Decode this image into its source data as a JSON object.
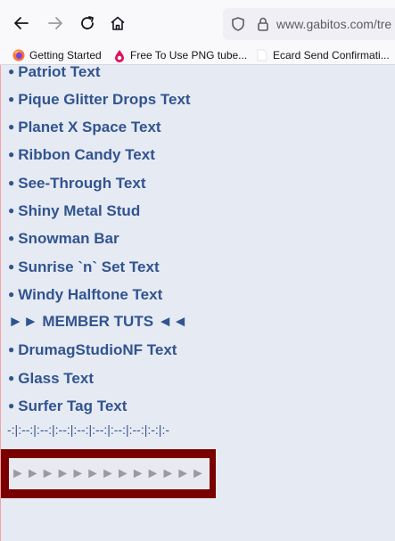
{
  "browser": {
    "url": "www.gabitos.com/tre",
    "bookmarks": [
      {
        "label": "Getting Started",
        "icon": "firefox-icon"
      },
      {
        "label": "Free To Use PNG tube...",
        "icon": "pink-drop-icon"
      },
      {
        "label": "Ecard Send Confirmati...",
        "icon": "blank-page-icon"
      }
    ]
  },
  "content": {
    "items": [
      "Patriot Text",
      "Pique Glitter Drops Text",
      "Planet X Space Text",
      "Ribbon Candy Text",
      "See-Through Text",
      "Shiny Metal Stud",
      "Snowman Bar",
      "Sunrise `n` Set Text",
      "Windy Halftone Text",
      "►► MEMBER TUTS ◄◄",
      "DrumagStudioNF Text",
      "Glass Text",
      "Surfer Tag Text"
    ],
    "bullet": "●",
    "divider": "-:|:--:|:--:|:--:|:--:|:--:|:--:|:--:|:-:|:-",
    "arrow_row": "►►►►►►►►►►►►►"
  },
  "colors": {
    "link": "#31548f",
    "page_bg": "#e6eaf3",
    "box_border": "#7a0000"
  }
}
